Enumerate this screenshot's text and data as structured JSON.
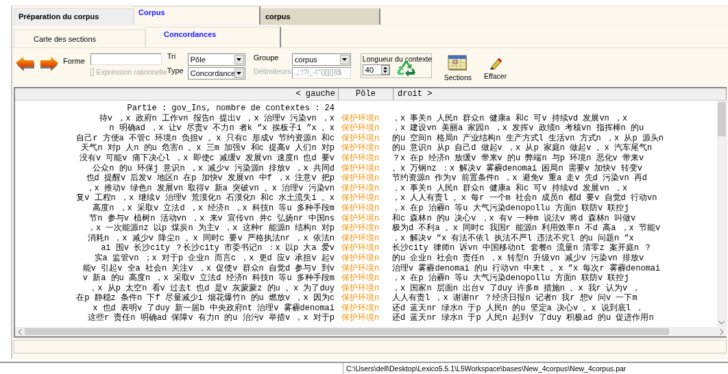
{
  "tabs": [
    {
      "label": "Préparation du corpus",
      "selected": false
    },
    {
      "label": "Corpus",
      "selected": true
    },
    {
      "label": "corpus",
      "selected": false
    }
  ],
  "subtabs": [
    {
      "label": "Carte des sections",
      "selected": false
    },
    {
      "label": "Concordances",
      "selected": true
    }
  ],
  "toolbar": {
    "forme": {
      "label": "Forme"
    },
    "regex": {
      "label": "Expression rationnelle",
      "checked": false,
      "disabled": true
    },
    "tri": {
      "label": "Tri",
      "value": "Pôle"
    },
    "type": {
      "label": "Type",
      "value": "Concordance"
    },
    "groupe": {
      "label": "Groupe",
      "value": "corpus"
    },
    "delimiteurs": {
      "label": "Délimiteurs",
      "value": ".,;:!?/_-\\'\"()[]{}§$",
      "disabled": true
    },
    "longueur": {
      "label": "Longueur du contexte",
      "value": "40"
    },
    "buttons": [
      {
        "label": "Sections",
        "kind": "calendar"
      },
      {
        "label": "Effacer",
        "kind": "eraser"
      }
    ]
  },
  "concordance": {
    "columns": [
      "< gauche",
      "Pôle",
      "droit >"
    ],
    "heading": "Partie : gov_Ins, nombre de contextes : 24",
    "rows": [
      {
        "left": "待v ，x 政府n 工作vn 报告n 提出v ，x 治理v 污染vn ，x",
        "pole": "保护环境n",
        "right": "，x 事关n 人民n 群众n 健康a 和c 可v 持续vd 发展vn ，x"
      },
      {
        "left": "n 明确ad ，x 让v 尽责v 不力n 者k ”x 挨板子i ”x 。x",
        "pole": "保护环境n",
        "right": "，x 建设vn 美丽a 家园n ，x 发挥v 政绩n 考核vn 指挥棒n 的u"
      },
      {
        "left": "自己r 方便a 不管c 环境n 负担v 。x 只有c 形成v 节约资源n 和c",
        "pole": "保护环境n",
        "right": "的u 空间n 格局n 产业结构n 生产方式l 生活vn 方式n ，x 从p 源头n"
      },
      {
        "left": "天气n 对p 人n 的u 危害n 。x 三m 加强v 和c 提高v 人们n 对p",
        "pole": "保护环境n",
        "right": "的u 意识n 从p 自己d 做起v ，x 从p 家庭n 做起v 。x 汽车尾气n"
      },
      {
        "left": "没有v 可能v 痛下决心l ，x 即使c 减缓v 发展vn 速度n 也d 要v",
        "pole": "保护环境n",
        "right": "？x 在p 经济n 放缓v 带来v 的u 弊端n 与p 环境n 恶化v 带来v"
      },
      {
        "left": "公众n 的u 环保j 意识n ，x 减少v 污染源n 排放v ，x 共同d",
        "pole": "保护环境n",
        "right": "。x 万钢nz ：x 解决v 雾霾denomai 困局n 需要v 加快v 转变v"
      },
      {
        "left": "也d 提醒v 后发v 地区n 在p 加快v 发展vn 中f ，x 注意v 把p",
        "pole": "保护环境n",
        "right": "节约资源n 作为v 前置条件n ，x 避免v 重a 走v 先d 污染vn 再d"
      },
      {
        "left": "，x 推动v 绿色n 发展vn 取得v 新a 突破vn 。x 治理v 污染vn",
        "pole": "保护环境n",
        "right": "，x 事关n 人民n 群众n 健康a 和c 可v 持续vd 发展vn ，x"
      },
      {
        "left": "复v 工程n ，x 继续v 治理v 荒漠化n 石漠化n 和c 水土流失i 。x",
        "pole": "保护环境n",
        "right": "，x 人人有责l 。x 每r 一个m 社会n 成员n 都d 要v 自觉d 行动vn"
      },
      {
        "left": "高度n ，x 采取v 立法d ，x 经济n ，x 科技n 等u 多种手段m",
        "pole": "保护环境n",
        "right": "，x 在p 治霾n 等u 大气污染denopollu 方面n 联防v 联控j"
      },
      {
        "left": "节n 参与v 植树n 活动vn ，x 来v 宣传vn 并c 弘扬nr 中国ns",
        "pole": "保护环境n",
        "right": "和c 森林n 的u 决心v ，x 有v 一种m 说法v 将d 森林n 叫做v"
      },
      {
        "left": "，x 一次能源nz 以p 煤炭n 为主v ，x 这种r 能源n 结构n 对p",
        "pole": "保护环境n",
        "right": "极为d 不利a 。x 同时c 我国r 能源n 利用效率n 不d 高a ，x 节能v"
      },
      {
        "left": "消耗n ，x 减少v 降尘n 。x 同时c 要v 严格执法nr ，x 依法n",
        "pole": "保护环境n",
        "right": "，x 解决v ”x 有法不依l 执法不严l 违法不究l 的u 问题n ”x"
      },
      {
        "left": "ai 围v 长沙city ？长沙city 市委书记n ：x 以p 大a 爱v",
        "pole": "保护环境n",
        "right": "长沙city 律师n 诉vn 中国移动nt 套餐n 流量n 清零z 案开庭n ？"
      },
      {
        "left": "实a 监管vn ；x 对于p 企业n 而言c ，x 更d 应v 承担v 起v",
        "pole": "保护环境n",
        "right": "的u 企业n 社会n 责任n ，x 转型n 升级vn 减少v 污染vn 排放v"
      },
      {
        "left": "能v 引起v 全a 社会n 关注v ，x 促使v 群众n 自觉d 参与v 到v",
        "pole": "保护环境n",
        "right": "治理v 雾霾denomai 的u 行动vn 中来t 。x ”x 每次r 雾霾denomai"
      },
      {
        "left": "v 新a 的u 高度n ，x 采取v 立法d 经济n 科技n 等u 多种手段m",
        "pole": "保护环境n",
        "right": "，x 在p 治霾n 等u 大气污染denopollu 方面n 联防v 联控j"
      },
      {
        "left": "，x 从p 太空n 看v 过去t 也d 是v 灰蒙蒙z 的u 。x 为了duy",
        "pole": "保护环境n",
        "right": "，x 国家n 层面n 出台v 了duy 许多m 措施n 。x 我r 认为v ，"
      },
      {
        "left": "在p 静稳z 条件n 下f 尽量减少i 烟花爆竹n 的u 燃放v ，x 因为c",
        "pole": "保护环境n",
        "right": "人人有责l ，x 谢谢nr ？经济日报n 记者n 我r 想v 问v 一下m"
      },
      {
        "left": "x 也d 表明v 了duy 新一届b 中央政府nt 治理v 雾霾denomai",
        "pole": "保护环境n",
        "right": "还d 蓝天nr 绿水n 于p 人民n 的u 坚定a 决心v 。x 说到底l ，"
      },
      {
        "left": "这些r 责任n 明确ad 保障v 有力n 的u 治污v 举措v ，x 对于p",
        "pole": "保护环境n",
        "right": "还d 蓝天nr 绿水n 于p 人民n 起到v 了duy 积极ad 的u 促进作用n"
      }
    ]
  },
  "status_bar": {
    "path": "C:\\Users\\dell\\Desktop\\Lexico5.5.1\\L5Workspace\\bases\\New_4corpus\\New_4corpus.par"
  }
}
